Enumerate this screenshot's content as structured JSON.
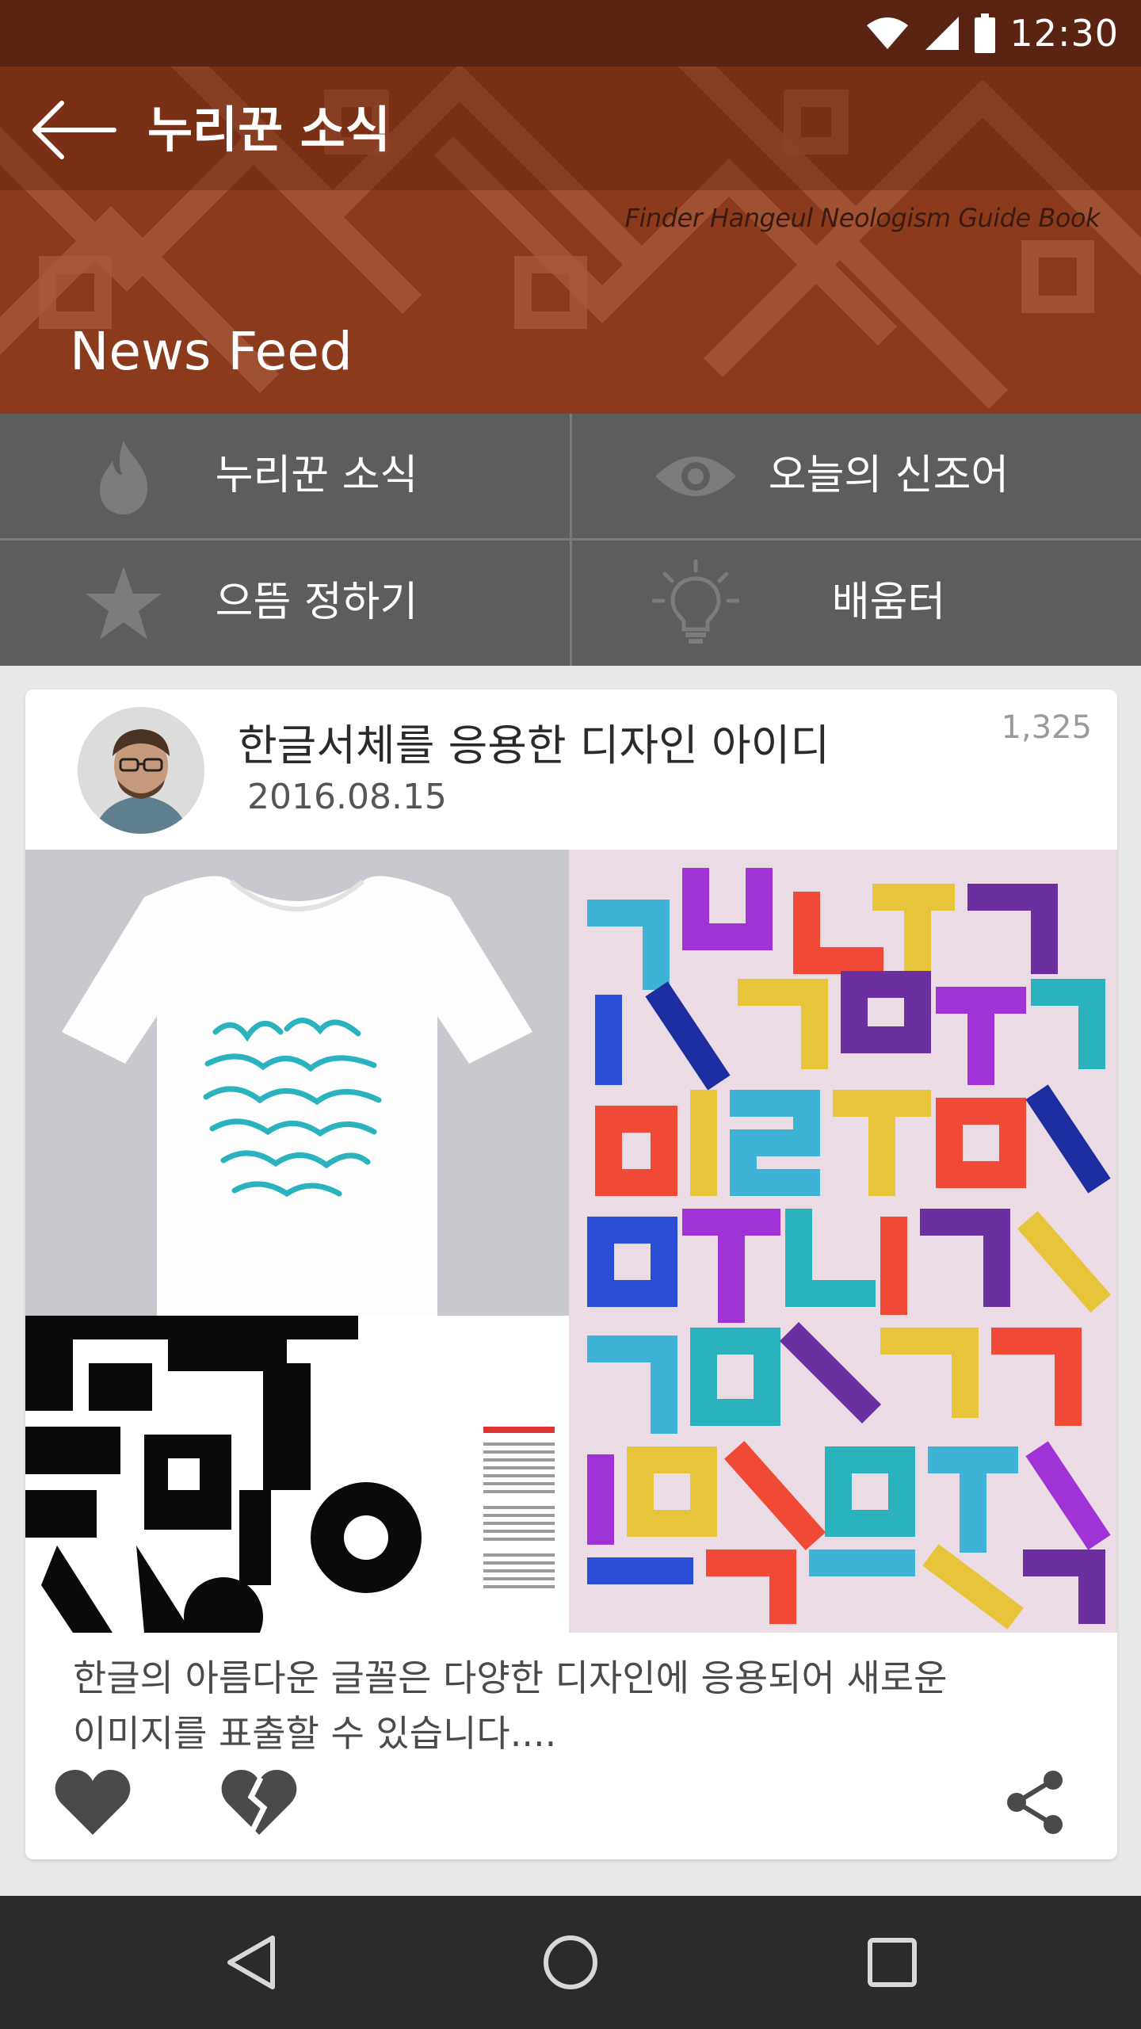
{
  "status_bar": {
    "time": "12:30",
    "icons": [
      "wifi-icon",
      "signal-icon",
      "battery-icon"
    ]
  },
  "header": {
    "title": "누리꾼 소식",
    "guide_text": "Finder Hangeul Neologism Guide Book",
    "section_title": "News Feed",
    "background_color": "#8a3a1d",
    "status_color": "#5b2412"
  },
  "menu": {
    "items": [
      {
        "label": "누리꾼 소식",
        "icon": "flame-icon"
      },
      {
        "label": "오늘의 신조어",
        "icon": "eye-icon"
      },
      {
        "label": "으뜸 정하기",
        "icon": "star-icon"
      },
      {
        "label": "배움터",
        "icon": "lightbulb-icon"
      }
    ]
  },
  "post": {
    "title": "한글서체를 응용한 디자인 아이디",
    "date": "2016.08.15",
    "view_count": "1,325",
    "body_line1": "한글의 아름다운 글꼴은 다양한 디자인에 응용되어 새로운",
    "body_line2": "이미지를 표출할 수 있습니다....",
    "images": [
      "tshirt-image",
      "typography-poster-image",
      "bw-typography-image"
    ],
    "actions": [
      "heart-icon",
      "broken-heart-icon",
      "share-icon"
    ]
  },
  "nav": {
    "buttons": [
      "back-triangle-icon",
      "home-circle-icon",
      "recents-square-icon"
    ]
  }
}
